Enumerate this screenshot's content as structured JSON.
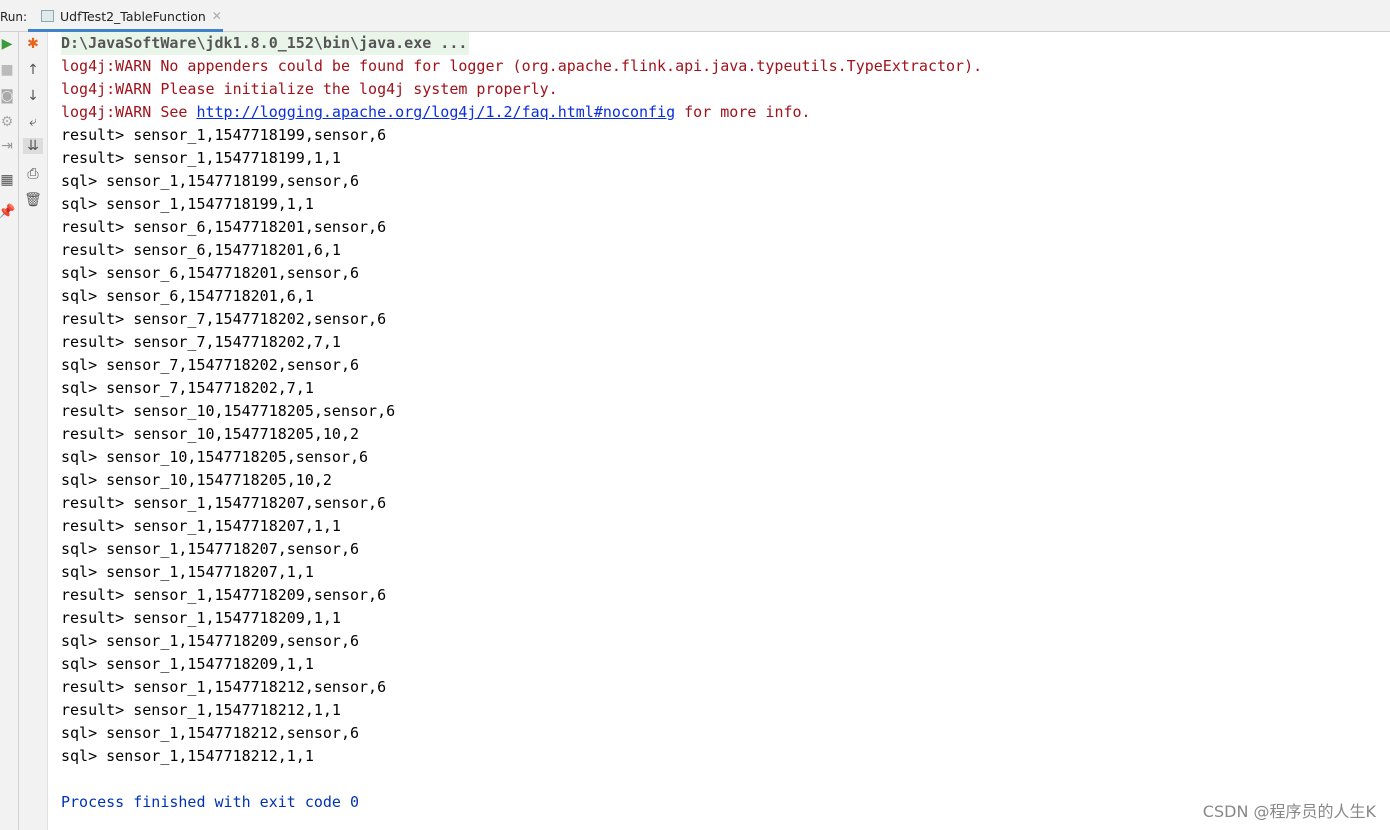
{
  "run_label": "Run:",
  "tab": {
    "title": "UdfTest2_TableFunction"
  },
  "console": {
    "command": "D:\\JavaSoftWare\\jdk1.8.0_152\\bin\\java.exe ...",
    "warn1": "log4j:WARN No appenders could be found for logger (org.apache.flink.api.java.typeutils.TypeExtractor).",
    "warn2": "log4j:WARN Please initialize the log4j system properly.",
    "warn3_pre": "log4j:WARN See ",
    "warn3_link": "http://logging.apache.org/log4j/1.2/faq.html#noconfig",
    "warn3_post": " for more info.",
    "lines": [
      "result> sensor_1,1547718199,sensor,6",
      "result> sensor_1,1547718199,1,1",
      "sql> sensor_1,1547718199,sensor,6",
      "sql> sensor_1,1547718199,1,1",
      "result> sensor_6,1547718201,sensor,6",
      "result> sensor_6,1547718201,6,1",
      "sql> sensor_6,1547718201,sensor,6",
      "sql> sensor_6,1547718201,6,1",
      "result> sensor_7,1547718202,sensor,6",
      "result> sensor_7,1547718202,7,1",
      "sql> sensor_7,1547718202,sensor,6",
      "sql> sensor_7,1547718202,7,1",
      "result> sensor_10,1547718205,sensor,6",
      "result> sensor_10,1547718205,10,2",
      "sql> sensor_10,1547718205,sensor,6",
      "sql> sensor_10,1547718205,10,2",
      "result> sensor_1,1547718207,sensor,6",
      "result> sensor_1,1547718207,1,1",
      "sql> sensor_1,1547718207,sensor,6",
      "sql> sensor_1,1547718207,1,1",
      "result> sensor_1,1547718209,sensor,6",
      "result> sensor_1,1547718209,1,1",
      "sql> sensor_1,1547718209,sensor,6",
      "sql> sensor_1,1547718209,1,1",
      "result> sensor_1,1547718212,sensor,6",
      "result> sensor_1,1547718212,1,1",
      "sql> sensor_1,1547718212,sensor,6",
      "sql> sensor_1,1547718212,1,1"
    ],
    "finished": "Process finished with exit code 0"
  },
  "watermark": "CSDN @程序员的人生K"
}
